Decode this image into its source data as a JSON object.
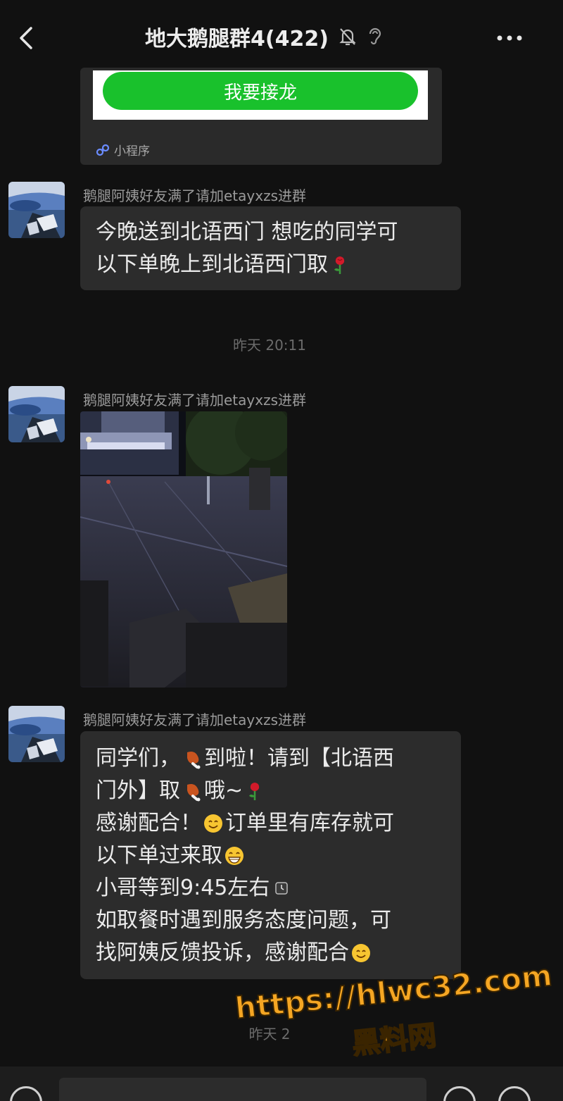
{
  "header": {
    "title": "地大鹅腿群4(422)",
    "back_icon": "chevron-left-icon",
    "mute_icon": "bell-off-icon",
    "earpiece_icon": "ear-icon",
    "more_icon": "more-dots-icon"
  },
  "mini_program": {
    "button_label": "我要接龙",
    "tag_label": "小程序",
    "accent": "#19c12c"
  },
  "messages": [
    {
      "sender": "鹅腿阿姨好友满了请加etayxzs进群",
      "lines": [
        "今晚送到北语西门 想吃的同学可",
        "以下单晚上到北语西门取"
      ]
    },
    {
      "sender": "鹅腿阿姨好友满了请加etayxzs进群",
      "type": "image"
    },
    {
      "sender": "鹅腿阿姨好友满了请加etayxzs进群",
      "lines": [
        "同学们，",
        "到啦！请到【北语西",
        "门外】取",
        "哦~",
        "感谢配合！",
        "订单里有库存就可",
        "以下单过来取",
        "小哥等到9:45左右",
        "如取餐时遇到服务态度问题，可",
        "找阿姨反馈投诉，感谢配合"
      ]
    }
  ],
  "timestamps": [
    "昨天 20:11",
    "昨天 2"
  ],
  "watermark": {
    "url": "https://hlwc32.com",
    "name": "黑料网",
    "color": "#f5a623"
  }
}
